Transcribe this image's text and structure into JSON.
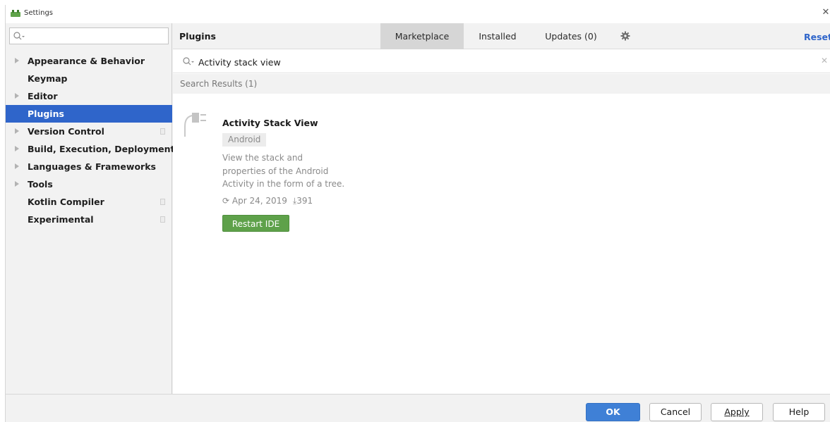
{
  "window": {
    "title": "Settings"
  },
  "sidebar": {
    "search_placeholder": "",
    "items": [
      {
        "label": "Appearance & Behavior",
        "expandable": true,
        "project_scoped": false
      },
      {
        "label": "Keymap",
        "expandable": false,
        "project_scoped": false
      },
      {
        "label": "Editor",
        "expandable": true,
        "project_scoped": false
      },
      {
        "label": "Plugins",
        "expandable": false,
        "project_scoped": false,
        "selected": true
      },
      {
        "label": "Version Control",
        "expandable": true,
        "project_scoped": true
      },
      {
        "label": "Build, Execution, Deployment",
        "expandable": true,
        "project_scoped": false
      },
      {
        "label": "Languages & Frameworks",
        "expandable": true,
        "project_scoped": false
      },
      {
        "label": "Tools",
        "expandable": true,
        "project_scoped": false
      },
      {
        "label": "Kotlin Compiler",
        "expandable": false,
        "project_scoped": true
      },
      {
        "label": "Experimental",
        "expandable": false,
        "project_scoped": true
      }
    ]
  },
  "main": {
    "title": "Plugins",
    "tabs": [
      {
        "label": "Marketplace",
        "active": true
      },
      {
        "label": "Installed",
        "active": false
      },
      {
        "label": "Updates (0)",
        "active": false
      }
    ],
    "settings_icon": "gear-icon",
    "reset_label": "Reset",
    "search": {
      "value": "Activity stack view"
    },
    "results_header": "Search Results (1)",
    "plugin": {
      "name": "Activity Stack View",
      "tag": "Android",
      "description": "View the stack and properties of the Android Activity in the form of a tree.",
      "date": "Apr 24, 2019",
      "downloads": "391",
      "action_label": "Restart IDE"
    }
  },
  "footer": {
    "ok_label": "OK",
    "cancel_label": "Cancel",
    "apply_label": "Apply",
    "help_label": "Help"
  },
  "colors": {
    "selection": "#2f65ca",
    "link": "#2f65ca",
    "ok_button": "#3f80d6",
    "restart_button": "#5ea14a"
  }
}
